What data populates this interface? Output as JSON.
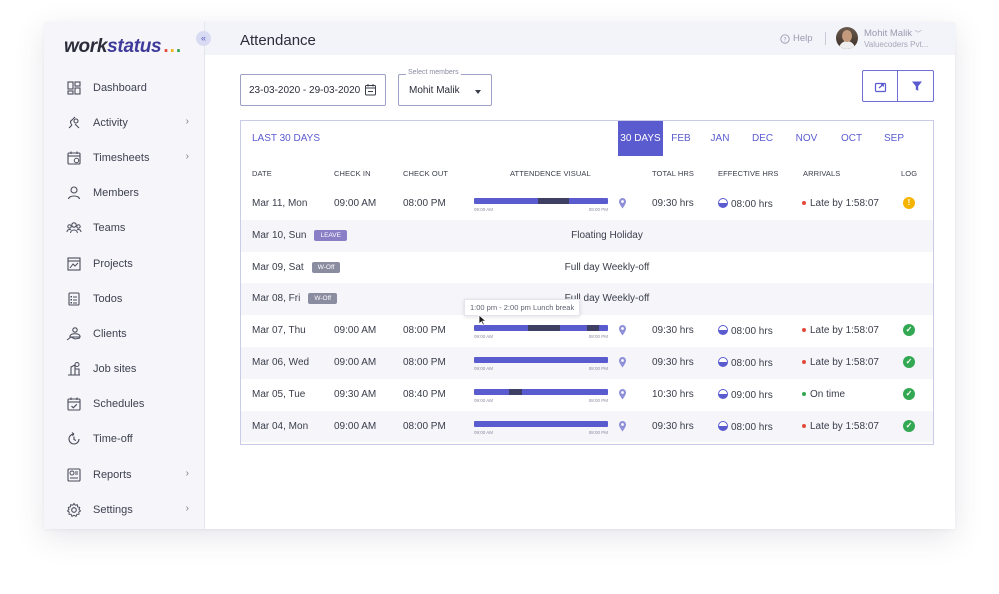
{
  "brand": {
    "logo_main": "work",
    "logo_accent": "status",
    "logo_dots": "...",
    "accent": "#5b5bd0"
  },
  "sidebar": {
    "items": [
      {
        "label": "Dashboard",
        "icon": "dashboard-icon",
        "chevron": false
      },
      {
        "label": "Activity",
        "icon": "activity-icon",
        "chevron": true
      },
      {
        "label": "Timesheets",
        "icon": "timesheets-icon",
        "chevron": true
      },
      {
        "label": "Members",
        "icon": "members-icon",
        "chevron": false
      },
      {
        "label": "Teams",
        "icon": "teams-icon",
        "chevron": false
      },
      {
        "label": "Projects",
        "icon": "projects-icon",
        "chevron": false
      },
      {
        "label": "Todos",
        "icon": "todos-icon",
        "chevron": false
      },
      {
        "label": "Clients",
        "icon": "clients-icon",
        "chevron": false
      },
      {
        "label": "Job sites",
        "icon": "job-sites-icon",
        "chevron": false
      },
      {
        "label": "Schedules",
        "icon": "schedules-icon",
        "chevron": false
      },
      {
        "label": "Time-off",
        "icon": "time-off-icon",
        "chevron": false
      },
      {
        "label": "Reports",
        "icon": "reports-icon",
        "chevron": true
      },
      {
        "label": "Settings",
        "icon": "settings-icon",
        "chevron": true
      }
    ]
  },
  "header": {
    "title": "Attendance",
    "help": "Help",
    "user_name": "Mohit Malik",
    "user_org": "Valuecoders Pvt..."
  },
  "filters": {
    "date_range": "23-03-2020 - 29-03-2020",
    "member_label": "Select members",
    "member_value": "Mohit Malik"
  },
  "period": {
    "label": "LAST 30 DAYS",
    "tabs": [
      "30 DAYS",
      "FEB",
      "JAN",
      "DEC",
      "NOV",
      "OCT",
      "SEP"
    ],
    "active_tab": "30 DAYS"
  },
  "table": {
    "columns": [
      "DATE",
      "CHECK IN",
      "CHECK OUT",
      "ATTENDENCE VISUAL",
      "TOTAL HRS",
      "EFFECTIVE HRS",
      "ARRIVALS",
      "LOG"
    ],
    "visual_start_label": "09:00 AM",
    "visual_end_label": "08:00 PM",
    "rows": [
      {
        "date": "Mar 11, Mon",
        "check_in": "09:00 AM",
        "check_out": "08:00 PM",
        "total": "09:30 hrs",
        "effective": "08:00 hrs",
        "arrival": "Late by 1:58:07",
        "arrival_status": "late",
        "log": "warning",
        "breaks": [
          [
            0.48,
            0.71
          ]
        ]
      },
      {
        "date": "Mar 10, Sun",
        "tag": "LEAVE",
        "tag_type": "leave",
        "note": "Floating Holiday"
      },
      {
        "date": "Mar 09, Sat",
        "tag": "W-Off",
        "tag_type": "off",
        "note": "Full day Weekly-off"
      },
      {
        "date": "Mar 08, Fri",
        "tag": "W-Off",
        "tag_type": "off",
        "note": "Full day Weekly-off"
      },
      {
        "date": "Mar 07, Thu",
        "check_in": "09:00 AM",
        "check_out": "08:00 PM",
        "total": "09:30 hrs",
        "effective": "08:00 hrs",
        "arrival": "Late by 1:58:07",
        "arrival_status": "late",
        "log": "ok",
        "breaks": [
          [
            0.4,
            0.64
          ],
          [
            0.84,
            0.93
          ]
        ]
      },
      {
        "date": "Mar 06, Wed",
        "check_in": "09:00 AM",
        "check_out": "08:00 PM",
        "total": "09:30 hrs",
        "effective": "08:00 hrs",
        "arrival": "Late by 1:58:07",
        "arrival_status": "late",
        "log": "ok",
        "breaks": []
      },
      {
        "date": "Mar 05, Tue",
        "check_in": "09:30 AM",
        "check_out": "08:40 PM",
        "total": "10:30 hrs",
        "effective": "09:00 hrs",
        "arrival": "On time",
        "arrival_status": "ontime",
        "log": "ok",
        "breaks": [
          [
            0.26,
            0.36
          ]
        ]
      },
      {
        "date": "Mar 04, Mon",
        "check_in": "09:00 AM",
        "check_out": "08:00 PM",
        "total": "09:30 hrs",
        "effective": "08:00 hrs",
        "arrival": "Late by 1:58:07",
        "arrival_status": "late",
        "log": "ok",
        "breaks": []
      }
    ]
  },
  "tooltip": {
    "text": "1:00 pm - 2:00 pm Lunch break"
  },
  "colors": {
    "late": "#e24b3b",
    "ontime": "#33a852",
    "ok": "#33a852",
    "warning": "#f5b400",
    "break": "#3e3f63"
  }
}
